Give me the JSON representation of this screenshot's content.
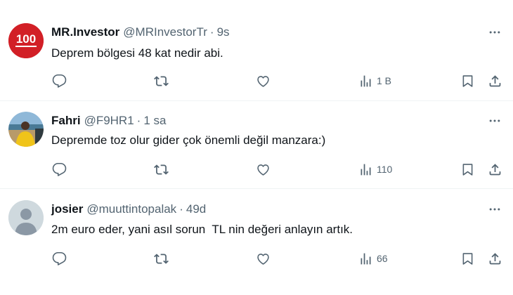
{
  "colors": {
    "text_primary": "#0f1419",
    "text_secondary": "#536471",
    "divider": "#eff3f4",
    "avatar1_red": "#d21f26",
    "avatar3_gray": "#cfd9de"
  },
  "tweets": [
    {
      "avatar_icon": "mr-investor-logo-icon",
      "avatar_logo_text": "100",
      "name": "MR.Investor",
      "handle": "@MRInvestorTr",
      "dot": "·",
      "time": "9s",
      "text": "Deprem bölgesi 48 kat nedir abi.",
      "views": "1 B"
    },
    {
      "avatar_icon": "user-photo-avatar",
      "name": "Fahri",
      "handle": "@F9HR1",
      "dot": "·",
      "time": "1 sa",
      "text": "Depremde toz olur gider çok önemli değil manzara:)",
      "views": "110"
    },
    {
      "avatar_icon": "default-profile-icon",
      "name": "josier",
      "handle": "@muuttintopalak",
      "dot": "·",
      "time": "49d",
      "text": "2m euro eder, yani asıl sorun  TL nin değeri anlayın artık.",
      "views": "66"
    }
  ],
  "action_icons": [
    "reply-icon",
    "retweet-icon",
    "like-icon",
    "views-icon",
    "bookmark-icon",
    "share-icon"
  ]
}
